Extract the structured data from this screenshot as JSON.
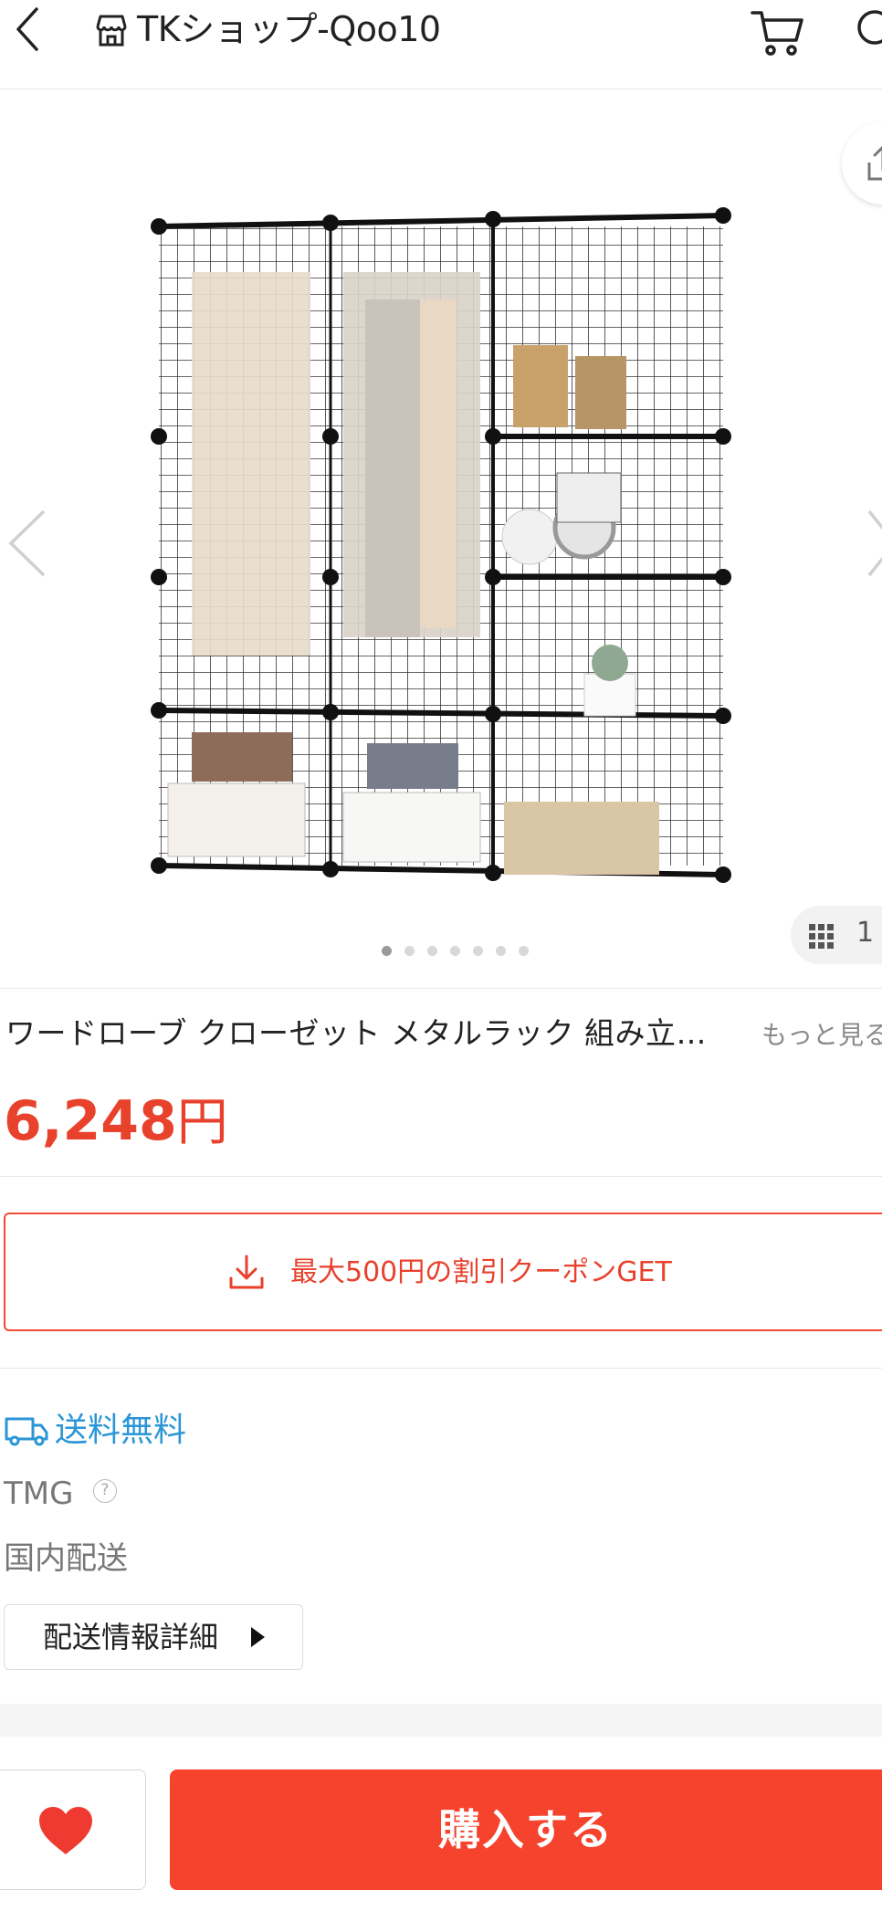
{
  "header": {
    "back_icon": "chevron-left-icon",
    "shop_icon": "storefront-icon",
    "shop_name": "TKショップ-Qoo10",
    "cart_icon": "cart-icon",
    "search_icon": "search-icon"
  },
  "gallery": {
    "image_alt": "ワードローブ クローゼット メタルラック",
    "share_icon": "share-icon",
    "counter_icon": "grid-icon",
    "counter_text": "1 /",
    "dot_count": 7,
    "active_dot": 1
  },
  "product": {
    "title": "ワードローブ クローゼット メタルラック 組み立…",
    "more_link": "もっと見る",
    "price_number": "6,248",
    "price_unit": "円"
  },
  "coupon": {
    "icon": "download-icon",
    "label": "最大500円の割引クーポンGET"
  },
  "shipping": {
    "free_icon": "truck-icon",
    "free_label": "送料無料",
    "company": "TMG",
    "help_icon": "?",
    "domestic": "国内配送",
    "detail_button": "配送情報詳細"
  },
  "bottom": {
    "wish_icon": "heart-icon",
    "buy_label": "購入する"
  },
  "colors": {
    "accent": "#f5432d",
    "price": "#e8412c",
    "link_blue": "#2b96d6"
  }
}
